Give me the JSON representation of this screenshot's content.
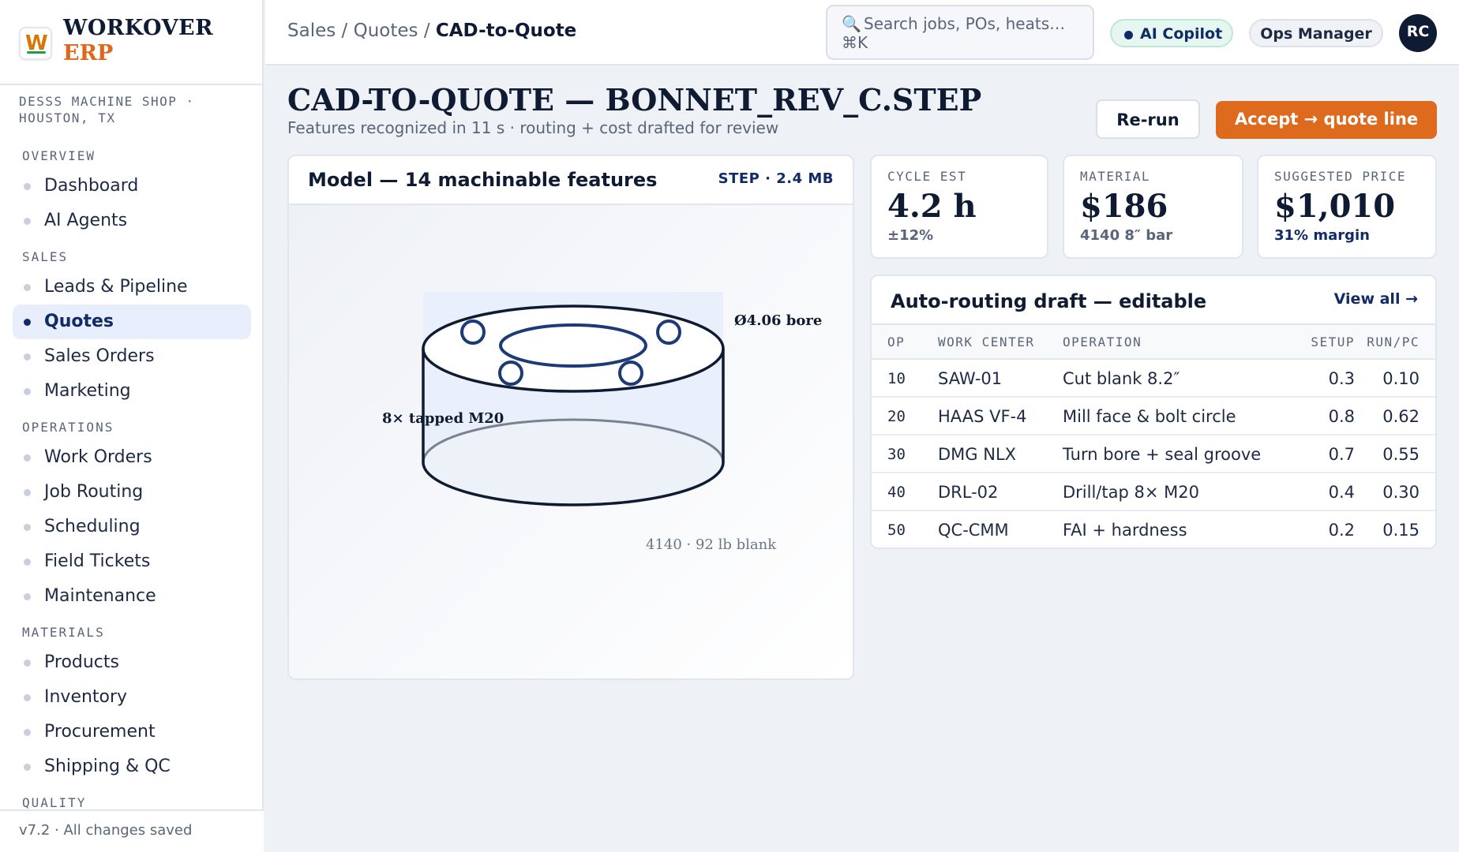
{
  "brand": {
    "logo_letter": "W",
    "name_top": "WORKOVER",
    "name_bottom": "ERP",
    "shop": "DESSS MACHINE SHOP · HOUSTON, TX"
  },
  "nav": {
    "overview": {
      "title": "OVERVIEW",
      "items": [
        "Dashboard",
        "AI Agents"
      ]
    },
    "sales": {
      "title": "SALES",
      "items": [
        "Leads & Pipeline",
        "Quotes",
        "Sales Orders",
        "Marketing"
      ]
    },
    "operations": {
      "title": "OPERATIONS",
      "items": [
        "Work Orders",
        "Job Routing",
        "Scheduling",
        "Field Tickets",
        "Maintenance"
      ]
    },
    "materials": {
      "title": "MATERIALS",
      "items": [
        "Products",
        "Inventory",
        "Procurement",
        "Shipping & QC"
      ]
    },
    "quality": {
      "title": "QUALITY"
    },
    "active": "Quotes"
  },
  "footer": "v7.2 · All changes saved",
  "header": {
    "crumb_1": "Sales",
    "crumb_2": "Quotes",
    "crumb_current": "CAD-to-Quote",
    "separator": "/",
    "search_icon": "🔍",
    "search_placeholder": "Search jobs, POs, heats… ⌘K",
    "copilot": "AI Copilot",
    "role": "Ops Manager",
    "avatar": "RC"
  },
  "page": {
    "title": "CAD-TO-QUOTE — BONNET_REV_C.STEP",
    "subtitle": "Features recognized in 11 s · routing + cost drafted for review",
    "rerun": "Re-run",
    "accept": "Accept → quote line"
  },
  "model": {
    "title": "Model — 14 machinable features",
    "file": "STEP · 2.4 MB",
    "label_bore": "Ø4.06 bore",
    "label_tap": "8× tapped M20",
    "label_blank": "4140 · 92 lb blank"
  },
  "kpis": [
    {
      "label": "CYCLE EST",
      "value": "4.2 h",
      "sub": "±12%",
      "sub_color": "#5a6579"
    },
    {
      "label": "MATERIAL",
      "value": "$186",
      "sub": "4140 8″ bar",
      "sub_color": "#5a6579"
    },
    {
      "label": "SUGGESTED PRICE",
      "value": "$1,010",
      "sub": "31% margin",
      "sub_color": "#102b66"
    }
  ],
  "routing": {
    "title": "Auto-routing draft — editable",
    "view_all": "View all →",
    "headers": {
      "op": "OP",
      "wc": "WORK CENTER",
      "operation": "OPERATION",
      "setup": "SETUP",
      "run": "RUN/PC"
    },
    "rows": [
      {
        "op": "10",
        "wc": "SAW-01",
        "operation": "Cut blank 8.2″",
        "setup": "0.3",
        "run": "0.10"
      },
      {
        "op": "20",
        "wc": "HAAS VF-4",
        "operation": "Mill face & bolt circle",
        "setup": "0.8",
        "run": "0.62"
      },
      {
        "op": "30",
        "wc": "DMG NLX",
        "operation": "Turn bore + seal groove",
        "setup": "0.7",
        "run": "0.55"
      },
      {
        "op": "40",
        "wc": "DRL-02",
        "operation": "Drill/tap 8× M20",
        "setup": "0.4",
        "run": "0.30"
      },
      {
        "op": "50",
        "wc": "QC-CMM",
        "operation": "FAI + hardness",
        "setup": "0.2",
        "run": "0.15"
      }
    ]
  },
  "colors": {
    "accent": "#de6a1d",
    "navy": "#102b66",
    "ink": "#0f1b33"
  }
}
